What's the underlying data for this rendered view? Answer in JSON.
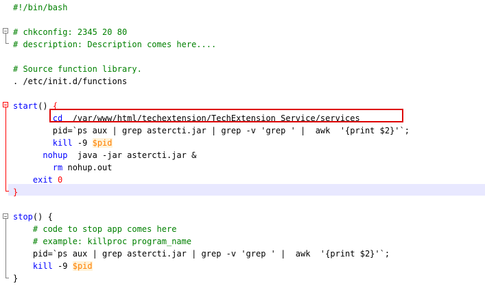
{
  "editor": {
    "lines": [
      {
        "id": "l1",
        "parts": [
          {
            "t": "#!/bin/bash",
            "c": "comment"
          }
        ]
      },
      {
        "id": "l2",
        "parts": []
      },
      {
        "id": "l3",
        "parts": [
          {
            "t": "# chkconfig: 2345 20 80",
            "c": "comment"
          }
        ]
      },
      {
        "id": "l4",
        "parts": [
          {
            "t": "# description: Description comes here....",
            "c": "comment"
          }
        ]
      },
      {
        "id": "l5",
        "parts": []
      },
      {
        "id": "l6",
        "parts": [
          {
            "t": "# Source function library.",
            "c": "comment"
          }
        ]
      },
      {
        "id": "l7",
        "parts": [
          {
            "t": ". /etc/init.d/functions",
            "c": "plain"
          }
        ]
      },
      {
        "id": "l8",
        "parts": []
      },
      {
        "id": "l9",
        "parts": [
          {
            "t": "start",
            "c": "fn"
          },
          {
            "t": "() ",
            "c": "plain"
          },
          {
            "t": "{",
            "c": "brace-red"
          }
        ]
      },
      {
        "id": "l10",
        "parts": [
          {
            "t": "        ",
            "c": "plain"
          },
          {
            "t": "cd",
            "c": "kw"
          },
          {
            "t": "  /var/www/html/techextension/TechExtension Service/services",
            "c": "plain"
          }
        ]
      },
      {
        "id": "l11",
        "parts": [
          {
            "t": "        pid=`ps aux | grep astercti.jar | grep -v 'grep ' |  awk  '{print $2}'`;",
            "c": "plain"
          }
        ]
      },
      {
        "id": "l12",
        "parts": [
          {
            "t": "        ",
            "c": "plain"
          },
          {
            "t": "kill",
            "c": "kw"
          },
          {
            "t": " -9 ",
            "c": "plain"
          },
          {
            "t": "$pid",
            "c": "var"
          }
        ]
      },
      {
        "id": "l13",
        "parts": [
          {
            "t": "      ",
            "c": "plain"
          },
          {
            "t": "nohup",
            "c": "kw"
          },
          {
            "t": "  java -jar astercti.jar &",
            "c": "plain"
          }
        ]
      },
      {
        "id": "l14",
        "parts": [
          {
            "t": "        ",
            "c": "plain"
          },
          {
            "t": "rm",
            "c": "kw"
          },
          {
            "t": " nohup.out",
            "c": "plain"
          }
        ]
      },
      {
        "id": "l15",
        "parts": [
          {
            "t": "    ",
            "c": "plain"
          },
          {
            "t": "exit",
            "c": "kw"
          },
          {
            "t": " ",
            "c": "plain"
          },
          {
            "t": "0",
            "c": "num"
          }
        ]
      },
      {
        "id": "l16",
        "parts": [
          {
            "t": "}",
            "c": "brace-red"
          }
        ]
      },
      {
        "id": "l17",
        "parts": []
      },
      {
        "id": "l18",
        "parts": [
          {
            "t": "stop",
            "c": "fn"
          },
          {
            "t": "() {",
            "c": "plain"
          }
        ]
      },
      {
        "id": "l19",
        "parts": [
          {
            "t": "    # code to stop app comes here",
            "c": "comment"
          }
        ]
      },
      {
        "id": "l20",
        "parts": [
          {
            "t": "    # example: killproc program_name",
            "c": "comment"
          }
        ]
      },
      {
        "id": "l21",
        "parts": [
          {
            "t": "    pid=`ps aux | grep astercti.jar | grep -v 'grep ' |  awk  '{print $2}'`;",
            "c": "plain"
          }
        ]
      },
      {
        "id": "l22",
        "parts": [
          {
            "t": "    ",
            "c": "plain"
          },
          {
            "t": "kill",
            "c": "kw"
          },
          {
            "t": " -9 ",
            "c": "plain"
          },
          {
            "t": "$pid",
            "c": "var"
          }
        ]
      },
      {
        "id": "l23",
        "parts": [
          {
            "t": "}",
            "c": "plain"
          }
        ]
      }
    ]
  },
  "colors": {
    "comment": "#008000",
    "keyword": "#0000ff",
    "variable": "#ff8000",
    "current_line": "#e8e8ff",
    "highlight_border": "#dd0000",
    "fold_gray": "#808080",
    "fold_red": "#ff0000"
  }
}
